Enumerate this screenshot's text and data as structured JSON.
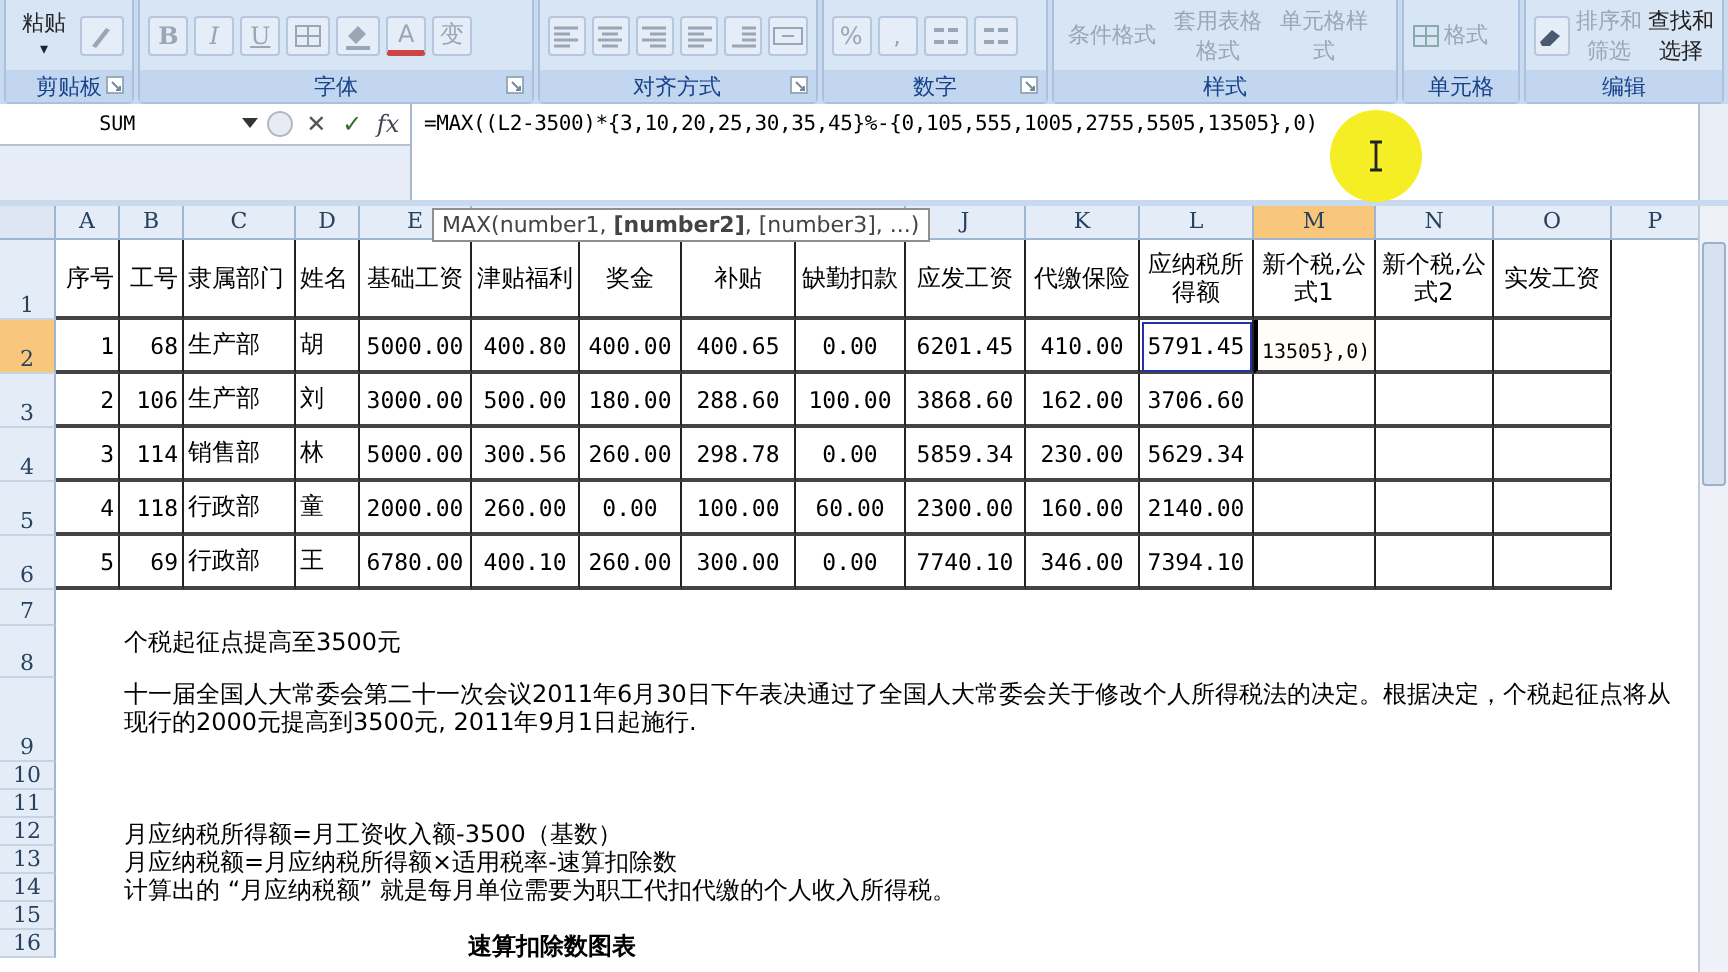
{
  "ribbon": {
    "groups": [
      {
        "label": "剪贴板",
        "launcher": true,
        "items": [
          {
            "kind": "paste",
            "label": "粘贴",
            "caret": "▾",
            "disabled": false
          },
          {
            "kind": "brush",
            "disabled": true
          }
        ]
      },
      {
        "label": "字体",
        "launcher": true,
        "items": [
          {
            "kind": "bold",
            "label": "B",
            "disabled": true
          },
          {
            "kind": "italic",
            "label": "I",
            "disabled": true
          },
          {
            "kind": "underline",
            "label": "U",
            "disabled": true
          },
          {
            "kind": "border",
            "disabled": true
          },
          {
            "kind": "fill",
            "disabled": true
          },
          {
            "kind": "font_color",
            "label": "A",
            "disabled": true
          },
          {
            "kind": "phonetic",
            "label": "变",
            "disabled": true
          }
        ]
      },
      {
        "label": "对齐方式",
        "launcher": true,
        "items": [
          {
            "kind": "align_left",
            "disabled": true
          },
          {
            "kind": "align_center",
            "disabled": true
          },
          {
            "kind": "align_right",
            "disabled": true
          },
          {
            "kind": "outdent",
            "disabled": true
          },
          {
            "kind": "indent",
            "disabled": true
          },
          {
            "kind": "merge",
            "disabled": true
          }
        ]
      },
      {
        "label": "数字",
        "launcher": true,
        "items": [
          {
            "kind": "percent",
            "label": "%",
            "disabled": true
          },
          {
            "kind": "comma",
            "label": ",",
            "disabled": true
          },
          {
            "kind": "inc_decimal",
            "disabled": true
          },
          {
            "kind": "dec_decimal",
            "disabled": true
          }
        ]
      },
      {
        "label": "样式",
        "launcher": false,
        "items": [
          {
            "kind": "large",
            "label": "条件格式",
            "disabled": true
          },
          {
            "kind": "large",
            "label": "套用表格格式",
            "disabled": true
          },
          {
            "kind": "large",
            "label": "单元格样式",
            "disabled": true
          }
        ]
      },
      {
        "label": "单元格",
        "launcher": false,
        "items": [
          {
            "kind": "format",
            "label": "格式",
            "disabled": true
          }
        ]
      },
      {
        "label": "编辑",
        "launcher": false,
        "items": [
          {
            "kind": "eraser",
            "disabled": false
          },
          {
            "kind": "large",
            "label": "排序和筛选",
            "disabled": true
          },
          {
            "kind": "large",
            "label": "查找和选择",
            "disabled": false
          }
        ]
      }
    ]
  },
  "formula_bar": {
    "name_box": "SUM",
    "cancel": "✕",
    "enter": "✓",
    "function": "fx",
    "formula": "=MAX((L2-3500)*{3,10,20,25,30,35,45}%-{0,105,555,1005,2755,5505,13505},0)"
  },
  "tooltip": "MAX(number1, **[number2]**, [number3], ...)",
  "columns": [
    {
      "label": "A",
      "selected": false
    },
    {
      "label": "B",
      "selected": false
    },
    {
      "label": "C",
      "selected": false
    },
    {
      "label": "D",
      "selected": false
    },
    {
      "label": "E",
      "selected": false
    },
    {
      "label": "J",
      "selected": false
    },
    {
      "label": "K",
      "selected": false
    },
    {
      "label": "L",
      "selected": false
    },
    {
      "label": "M",
      "selected": true
    },
    {
      "label": "N",
      "selected": false
    },
    {
      "label": "O",
      "selected": false
    },
    {
      "label": "P",
      "selected": false
    }
  ],
  "table_rows": [
    {
      "label": "1",
      "selected": false,
      "cells": [
        "序号",
        "工号",
        "隶属部门",
        "姓名",
        "基础工资",
        "津贴福利",
        "奖金",
        "补贴",
        "缺勤扣款",
        "应发工资",
        "代缴保险",
        "应纳税所得额",
        "新个税,公式1",
        "新个税,公式2",
        "实发工资"
      ]
    },
    {
      "label": "2",
      "selected": true,
      "cells": [
        "1",
        "68",
        "生产部",
        "胡",
        "5000.00",
        "400.80",
        "400.00",
        "400.65",
        "0.00",
        "6201.45",
        "410.00",
        {
          "text": "5791.45",
          "referenced": true
        },
        {
          "text": "13505},0)",
          "editing": true
        },
        "",
        ""
      ]
    },
    {
      "label": "3",
      "selected": false,
      "cells": [
        "2",
        "106",
        "生产部",
        "刘",
        "3000.00",
        "500.00",
        "180.00",
        "288.60",
        "100.00",
        "3868.60",
        "162.00",
        "3706.60",
        "",
        "",
        ""
      ]
    },
    {
      "label": "4",
      "selected": false,
      "cells": [
        "3",
        "114",
        "销售部",
        "林",
        "5000.00",
        "300.56",
        "260.00",
        "298.78",
        "0.00",
        "5859.34",
        "230.00",
        "5629.34",
        "",
        "",
        ""
      ]
    },
    {
      "label": "5",
      "selected": false,
      "cells": [
        "4",
        "118",
        "行政部",
        "童",
        "2000.00",
        "260.00",
        "0.00",
        "100.00",
        "60.00",
        "2300.00",
        "160.00",
        "2140.00",
        "",
        "",
        ""
      ]
    },
    {
      "label": "6",
      "selected": false,
      "cells": [
        "5",
        "69",
        "行政部",
        "王",
        "6780.00",
        "400.10",
        "260.00",
        "300.00",
        "0.00",
        "7740.10",
        "346.00",
        "7394.10",
        "",
        "",
        ""
      ]
    }
  ],
  "note_rows": [
    {
      "label": "7"
    },
    {
      "label": "8",
      "text": "个税起征点提高至3500元"
    },
    {
      "label": "9",
      "text": "十一届全国人大常委会第二十一次会议2011年6月30日下午表决通过了全国人大常委会关于修改个人所得税法的决定。根据决定，个税起征点将从现行的2000元提高到3500元, 2011年9月1日起施行."
    },
    {
      "label": "10"
    },
    {
      "label": "11"
    },
    {
      "label": "12",
      "text": "月应纳税所得额=月工资收入额-3500（基数）"
    },
    {
      "label": "13",
      "text": "月应纳税额=月应纳税所得额×适用税率-速算扣除数"
    },
    {
      "label": "14",
      "text": "计算出的 “月应纳税额” 就是每月单位需要为职工代扣代缴的个人收入所得税。"
    },
    {
      "label": "15"
    },
    {
      "label": "16",
      "text": "速算扣除数图表",
      "kind": "heading"
    }
  ]
}
